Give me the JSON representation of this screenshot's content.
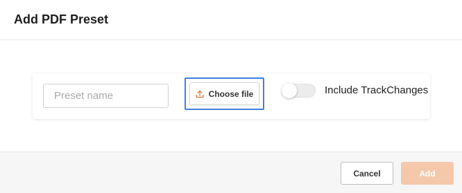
{
  "dialog": {
    "title": "Add PDF Preset"
  },
  "form": {
    "preset_name": {
      "value": "",
      "placeholder": "Preset name"
    },
    "choose_file": {
      "label": "Choose file",
      "icon": "upload-icon"
    },
    "track_changes": {
      "label": "Include TrackChanges",
      "enabled": false
    }
  },
  "footer": {
    "cancel_label": "Cancel",
    "add_label": "Add",
    "add_disabled": true
  },
  "colors": {
    "accent": "#e8702a",
    "focus_ring": "#3d7fe0",
    "add_disabled_bg": "#f5c7ab"
  }
}
